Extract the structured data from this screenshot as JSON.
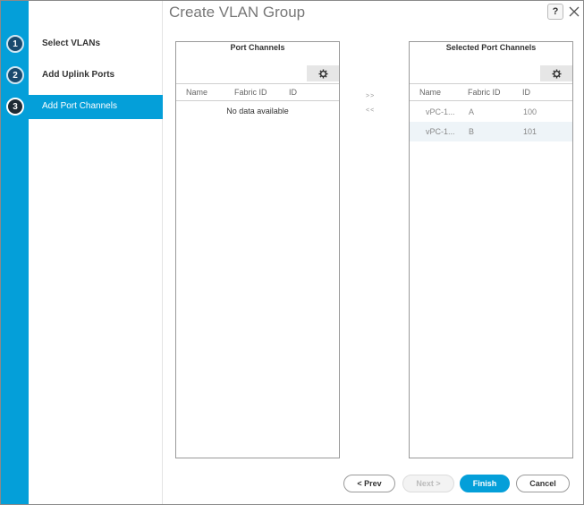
{
  "window": {
    "title": "Create VLAN Group",
    "help_label": "?",
    "close_label": "✕"
  },
  "wizard": {
    "accent_color": "#049fd9",
    "steps": [
      {
        "number": "1",
        "label": "Select VLANs",
        "active": false
      },
      {
        "number": "2",
        "label": "Add Uplink Ports",
        "active": false
      },
      {
        "number": "3",
        "label": "Add Port Channels",
        "active": true
      }
    ]
  },
  "available_panel": {
    "title": "Port Channels",
    "columns": [
      "Name",
      "Fabric ID",
      "ID"
    ],
    "empty_text": "No data available",
    "settings_icon": "gear-icon"
  },
  "transfer": {
    "add_label": ">>",
    "remove_label": "<<"
  },
  "selected_panel": {
    "title": "Selected Port Channels",
    "columns": [
      "Name",
      "Fabric ID",
      "ID"
    ],
    "settings_icon": "gear-icon",
    "rows": [
      {
        "name": "vPC-1...",
        "fabric_id": "A",
        "id": "100"
      },
      {
        "name": "vPC-1...",
        "fabric_id": "B",
        "id": "101"
      }
    ]
  },
  "footer": {
    "prev_label": "< Prev",
    "next_label": "Next >",
    "finish_label": "Finish",
    "cancel_label": "Cancel"
  }
}
